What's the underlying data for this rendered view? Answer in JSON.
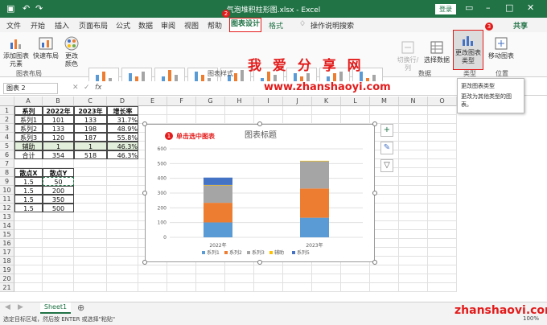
{
  "titlebar": {
    "title": "气泡堆积柱形图.xlsx - Excel",
    "login": "登录"
  },
  "tabs": [
    "文件",
    "开始",
    "插入",
    "页面布局",
    "公式",
    "数据",
    "审阅",
    "视图",
    "帮助",
    "图表设计",
    "格式"
  ],
  "search_hint": "操作说明搜索",
  "share": "共享",
  "steps": {
    "s1": "1",
    "s2": "2",
    "s3": "3",
    "step1_text": "单击选中图表"
  },
  "ribbon": {
    "add_element": "添加图表元素",
    "quick_layout": "快速布局",
    "change_colors": "更改颜色",
    "switch_rowcol": "切换行/列",
    "select_data": "选择数据",
    "change_type": "更改图表类型",
    "move_chart": "移动图表",
    "groups": {
      "layout": "图表布局",
      "styles": "图表样式",
      "data": "数据",
      "type": "类型",
      "location": "位置"
    }
  },
  "watermark": {
    "cn": "我 爱 分 享 网",
    "url": "www.zhanshaoyi.com",
    "bottom": "zhanshaoyi.com"
  },
  "tooltip": {
    "title": "更改图表类型",
    "desc": "更改为其他类型的图表。"
  },
  "namebox": "图表 2",
  "fx": "fx",
  "columns": [
    "A",
    "B",
    "C",
    "D",
    "E",
    "F",
    "G",
    "H",
    "I",
    "J",
    "K",
    "L",
    "M",
    "N",
    "O"
  ],
  "rows": [
    "1",
    "2",
    "3",
    "4",
    "5",
    "6",
    "7",
    "8",
    "9",
    "10",
    "11",
    "12",
    "13",
    "14",
    "15",
    "16",
    "17",
    "18",
    "19",
    "20",
    "21"
  ],
  "table": {
    "headers": [
      "系列",
      "2022年",
      "2023年",
      "增长率"
    ],
    "rows": [
      [
        "系列1",
        "101",
        "133",
        "31.7%"
      ],
      [
        "系列2",
        "133",
        "198",
        "48.9%"
      ],
      [
        "系列3",
        "120",
        "187",
        "55.8%"
      ],
      [
        "辅助",
        "1",
        "1",
        "46.3%"
      ],
      [
        "合计",
        "354",
        "518",
        "46.3%"
      ]
    ]
  },
  "table2": {
    "headers": [
      "散点X",
      "散点Y"
    ],
    "rows": [
      [
        "1.5",
        "50"
      ],
      [
        "1.5",
        "200"
      ],
      [
        "1.5",
        "350"
      ],
      [
        "1.5",
        "500"
      ]
    ]
  },
  "chart_data": {
    "type": "bar",
    "stacked": true,
    "title": "图表标题",
    "categories": [
      "2022年",
      "2023年"
    ],
    "ylim": [
      0,
      600
    ],
    "yticks": [
      "0",
      "100",
      "200",
      "300",
      "400",
      "500",
      "600"
    ],
    "series": [
      {
        "name": "系列1",
        "values": [
          101,
          133
        ],
        "color": "#5b9bd5"
      },
      {
        "name": "系列2",
        "values": [
          133,
          198
        ],
        "color": "#ed7d31"
      },
      {
        "name": "系列3",
        "values": [
          120,
          187
        ],
        "color": "#a5a5a5"
      },
      {
        "name": "辅助",
        "values": [
          1,
          1
        ],
        "color": "#ffc000"
      },
      {
        "name": "系列5",
        "values": [
          50,
          0
        ],
        "color": "#4472c4"
      }
    ]
  },
  "sheet": "Sheet1",
  "status": {
    "text": "选定目标区域，然后按 ENTER 或选择\"粘贴\"",
    "zoom": "100%"
  }
}
